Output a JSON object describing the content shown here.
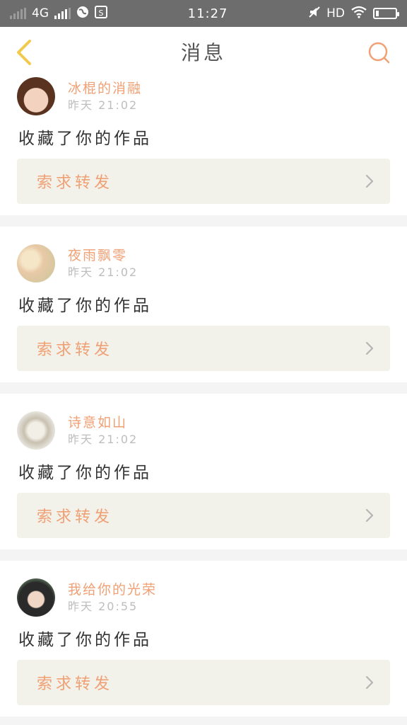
{
  "status_bar": {
    "network": "4G",
    "time": "11:27",
    "hd": "HD",
    "icons": [
      "signal-icon",
      "globe-icon",
      "sim-icon",
      "mute-icon",
      "wifi-icon",
      "battery-icon"
    ]
  },
  "navbar": {
    "title": "消息",
    "back_icon": "chevron-left-icon",
    "search_icon": "search-icon"
  },
  "colors": {
    "accent": "#f0a074",
    "back_icon": "#f2c94c",
    "request_bg": "#f2f2ea",
    "status_bar_bg": "#6d6d6d"
  },
  "messages": [
    {
      "username": "冰棍的消融",
      "time": "昨天 21:02",
      "action": "收藏了你的作品",
      "request": "索求转发"
    },
    {
      "username": "夜雨飘零",
      "time": "昨天 21:02",
      "action": "收藏了你的作品",
      "request": "索求转发"
    },
    {
      "username": "诗意如山",
      "time": "昨天 21:02",
      "action": "收藏了你的作品",
      "request": "索求转发"
    },
    {
      "username": "我给你的光荣",
      "time": "昨天 20:55",
      "action": "收藏了你的作品",
      "request": "索求转发"
    }
  ]
}
